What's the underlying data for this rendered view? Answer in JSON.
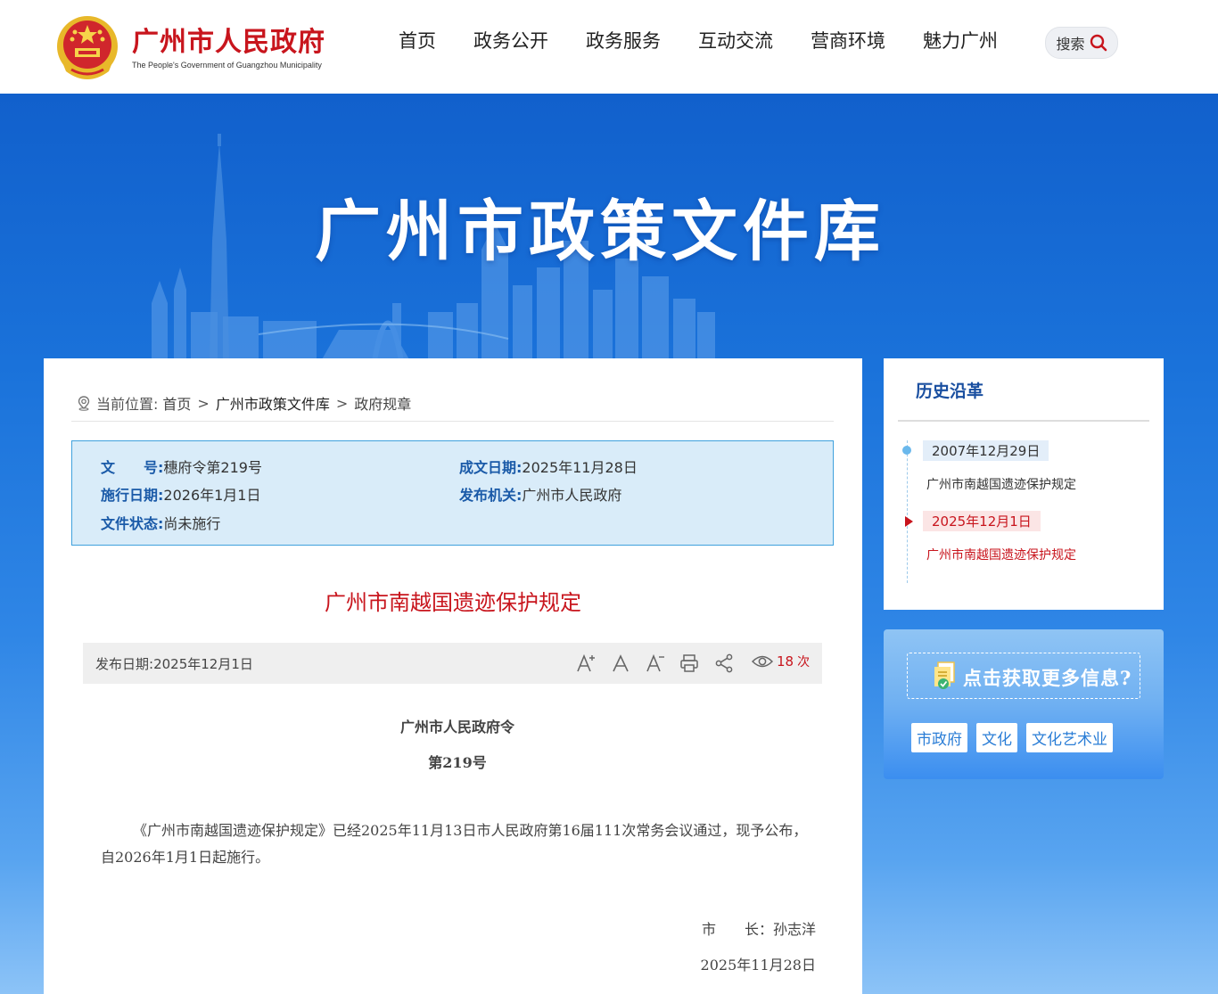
{
  "header": {
    "site_name": "广州市人民政府",
    "site_name_en": "The People's Government of Guangzhou Municipality",
    "nav": [
      "首页",
      "政务公开",
      "政务服务",
      "互动交流",
      "营商环境",
      "魅力广州"
    ],
    "search_label": "搜索"
  },
  "banner": {
    "title": "广州市政策文件库"
  },
  "breadcrumb": {
    "prefix": "当前位置:",
    "items": [
      "首页",
      "广州市政策文件库",
      "政府规章"
    ],
    "separator": ">"
  },
  "meta": {
    "doc_no_label": "文　　号:",
    "doc_no": "穗府令第219号",
    "created_label": "成文日期:",
    "created": "2025年11月28日",
    "effective_label": "施行日期:",
    "effective": "2026年1月1日",
    "issuer_label": "发布机关:",
    "issuer": "广州市人民政府",
    "status_label": "文件状态:",
    "status": "尚未施行"
  },
  "document": {
    "title": "广州市南越国遗迹保护规定",
    "publish_label": "发布日期:",
    "publish_date": "2025年12月1日",
    "views": "18",
    "views_unit": "次",
    "decree_title": "广州市人民政府令",
    "decree_no": "第219号",
    "body": "《广州市南越国遗迹保护规定》已经2025年11月13日市人民政府第16届111次常务会议通过，现予公布，自2026年1月1日起施行。",
    "signature": "市　　长：孙志洋",
    "sign_date": "2025年11月28日"
  },
  "history": {
    "title": "历史沿革",
    "items": [
      {
        "date": "2007年12月29日",
        "title": "广州市南越国遗迹保护规定"
      },
      {
        "date": "2025年12月1日",
        "title": "广州市南越国遗迹保护规定"
      }
    ]
  },
  "more_info": {
    "label": "点击获取更多信息?",
    "tags": [
      "市政府",
      "文化",
      "文化艺术业"
    ]
  },
  "colors": {
    "brand_red": "#c8151d",
    "banner_blue": "#1a6fd4",
    "label_blue": "#1a5aa8"
  }
}
